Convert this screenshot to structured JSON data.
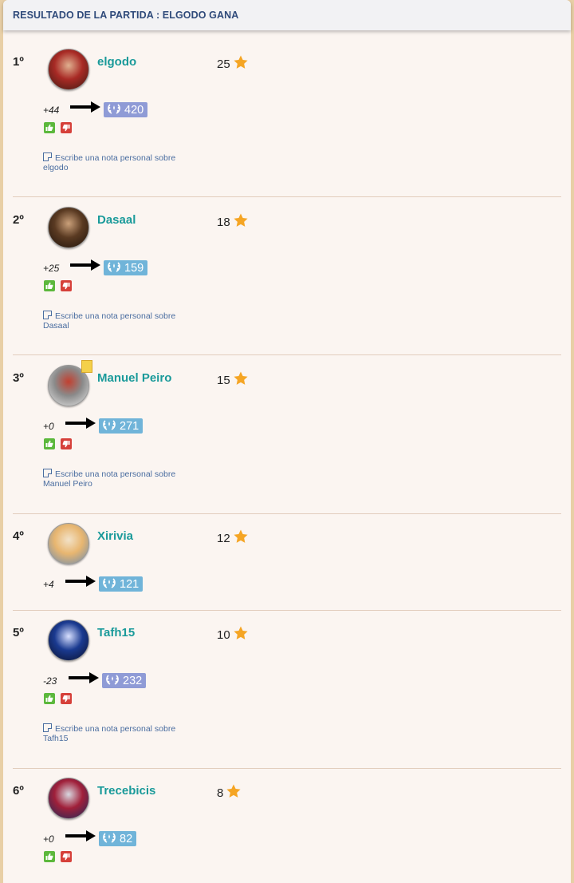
{
  "header": {
    "title": "RESULTADO DE LA PARTIDA : ELGODO GANA"
  },
  "players": [
    {
      "rank": "1º",
      "name": "elgodo",
      "score": "25",
      "delta": "+44",
      "elo": "420",
      "elo_style": "purple",
      "note": "Escribe una nota personal sobre elgodo",
      "has_thumbs": true,
      "has_note": true,
      "avatar_colors": [
        "#3b1a12",
        "#a82a25",
        "#e0b090"
      ]
    },
    {
      "rank": "2º",
      "name": "Dasaal",
      "score": "18",
      "delta": "+25",
      "elo": "159",
      "elo_style": "blue",
      "note": "Escribe una nota personal sobre Dasaal",
      "has_thumbs": true,
      "has_note": true,
      "avatar_colors": [
        "#1e120a",
        "#5a3a22",
        "#caa07a"
      ]
    },
    {
      "rank": "3º",
      "name": "Manuel Peiro",
      "score": "15",
      "delta": "+0",
      "elo": "271",
      "elo_style": "blue",
      "note": "Escribe una nota personal sobre Manuel Peiro",
      "has_thumbs": true,
      "has_note": true,
      "has_badge": true,
      "avatar_colors": [
        "#e6e6e6",
        "#8a8a8a",
        "#c24030"
      ]
    },
    {
      "rank": "4º",
      "name": "Xirivia",
      "score": "12",
      "delta": "+4",
      "elo": "121",
      "elo_style": "blue",
      "has_thumbs": false,
      "has_note": false,
      "avatar_colors": [
        "#6b8bb0",
        "#e8b670",
        "#f2e2c8"
      ]
    },
    {
      "rank": "5º",
      "name": "Tafh15",
      "score": "10",
      "delta": "-23",
      "elo": "232",
      "elo_style": "purple",
      "note": "Escribe una nota personal sobre Tafh15",
      "has_thumbs": true,
      "has_note": true,
      "avatar_colors": [
        "#0a0f2a",
        "#1a3a90",
        "#d8e0ff"
      ]
    },
    {
      "rank": "6º",
      "name": "Trecebicis",
      "score": "8",
      "delta": "+0",
      "elo": "82",
      "elo_style": "blue",
      "has_thumbs": true,
      "has_note": false,
      "avatar_colors": [
        "#1a2a5a",
        "#a0203a",
        "#d8d8e0"
      ]
    }
  ],
  "colors": {
    "name": "#1a9a9a",
    "star": "#f5a524",
    "elo_purple": "#8f9bd6",
    "elo_blue": "#70b4d9",
    "thumb_up": "#5cb83c",
    "thumb_down": "#d6403a"
  },
  "icons": {
    "star": "star-icon",
    "arrow": "arrow-right-icon",
    "wreath": "laurel-wreath-icon",
    "thumb_up": "thumbs-up-icon",
    "thumb_down": "thumbs-down-icon",
    "note": "note-icon"
  }
}
